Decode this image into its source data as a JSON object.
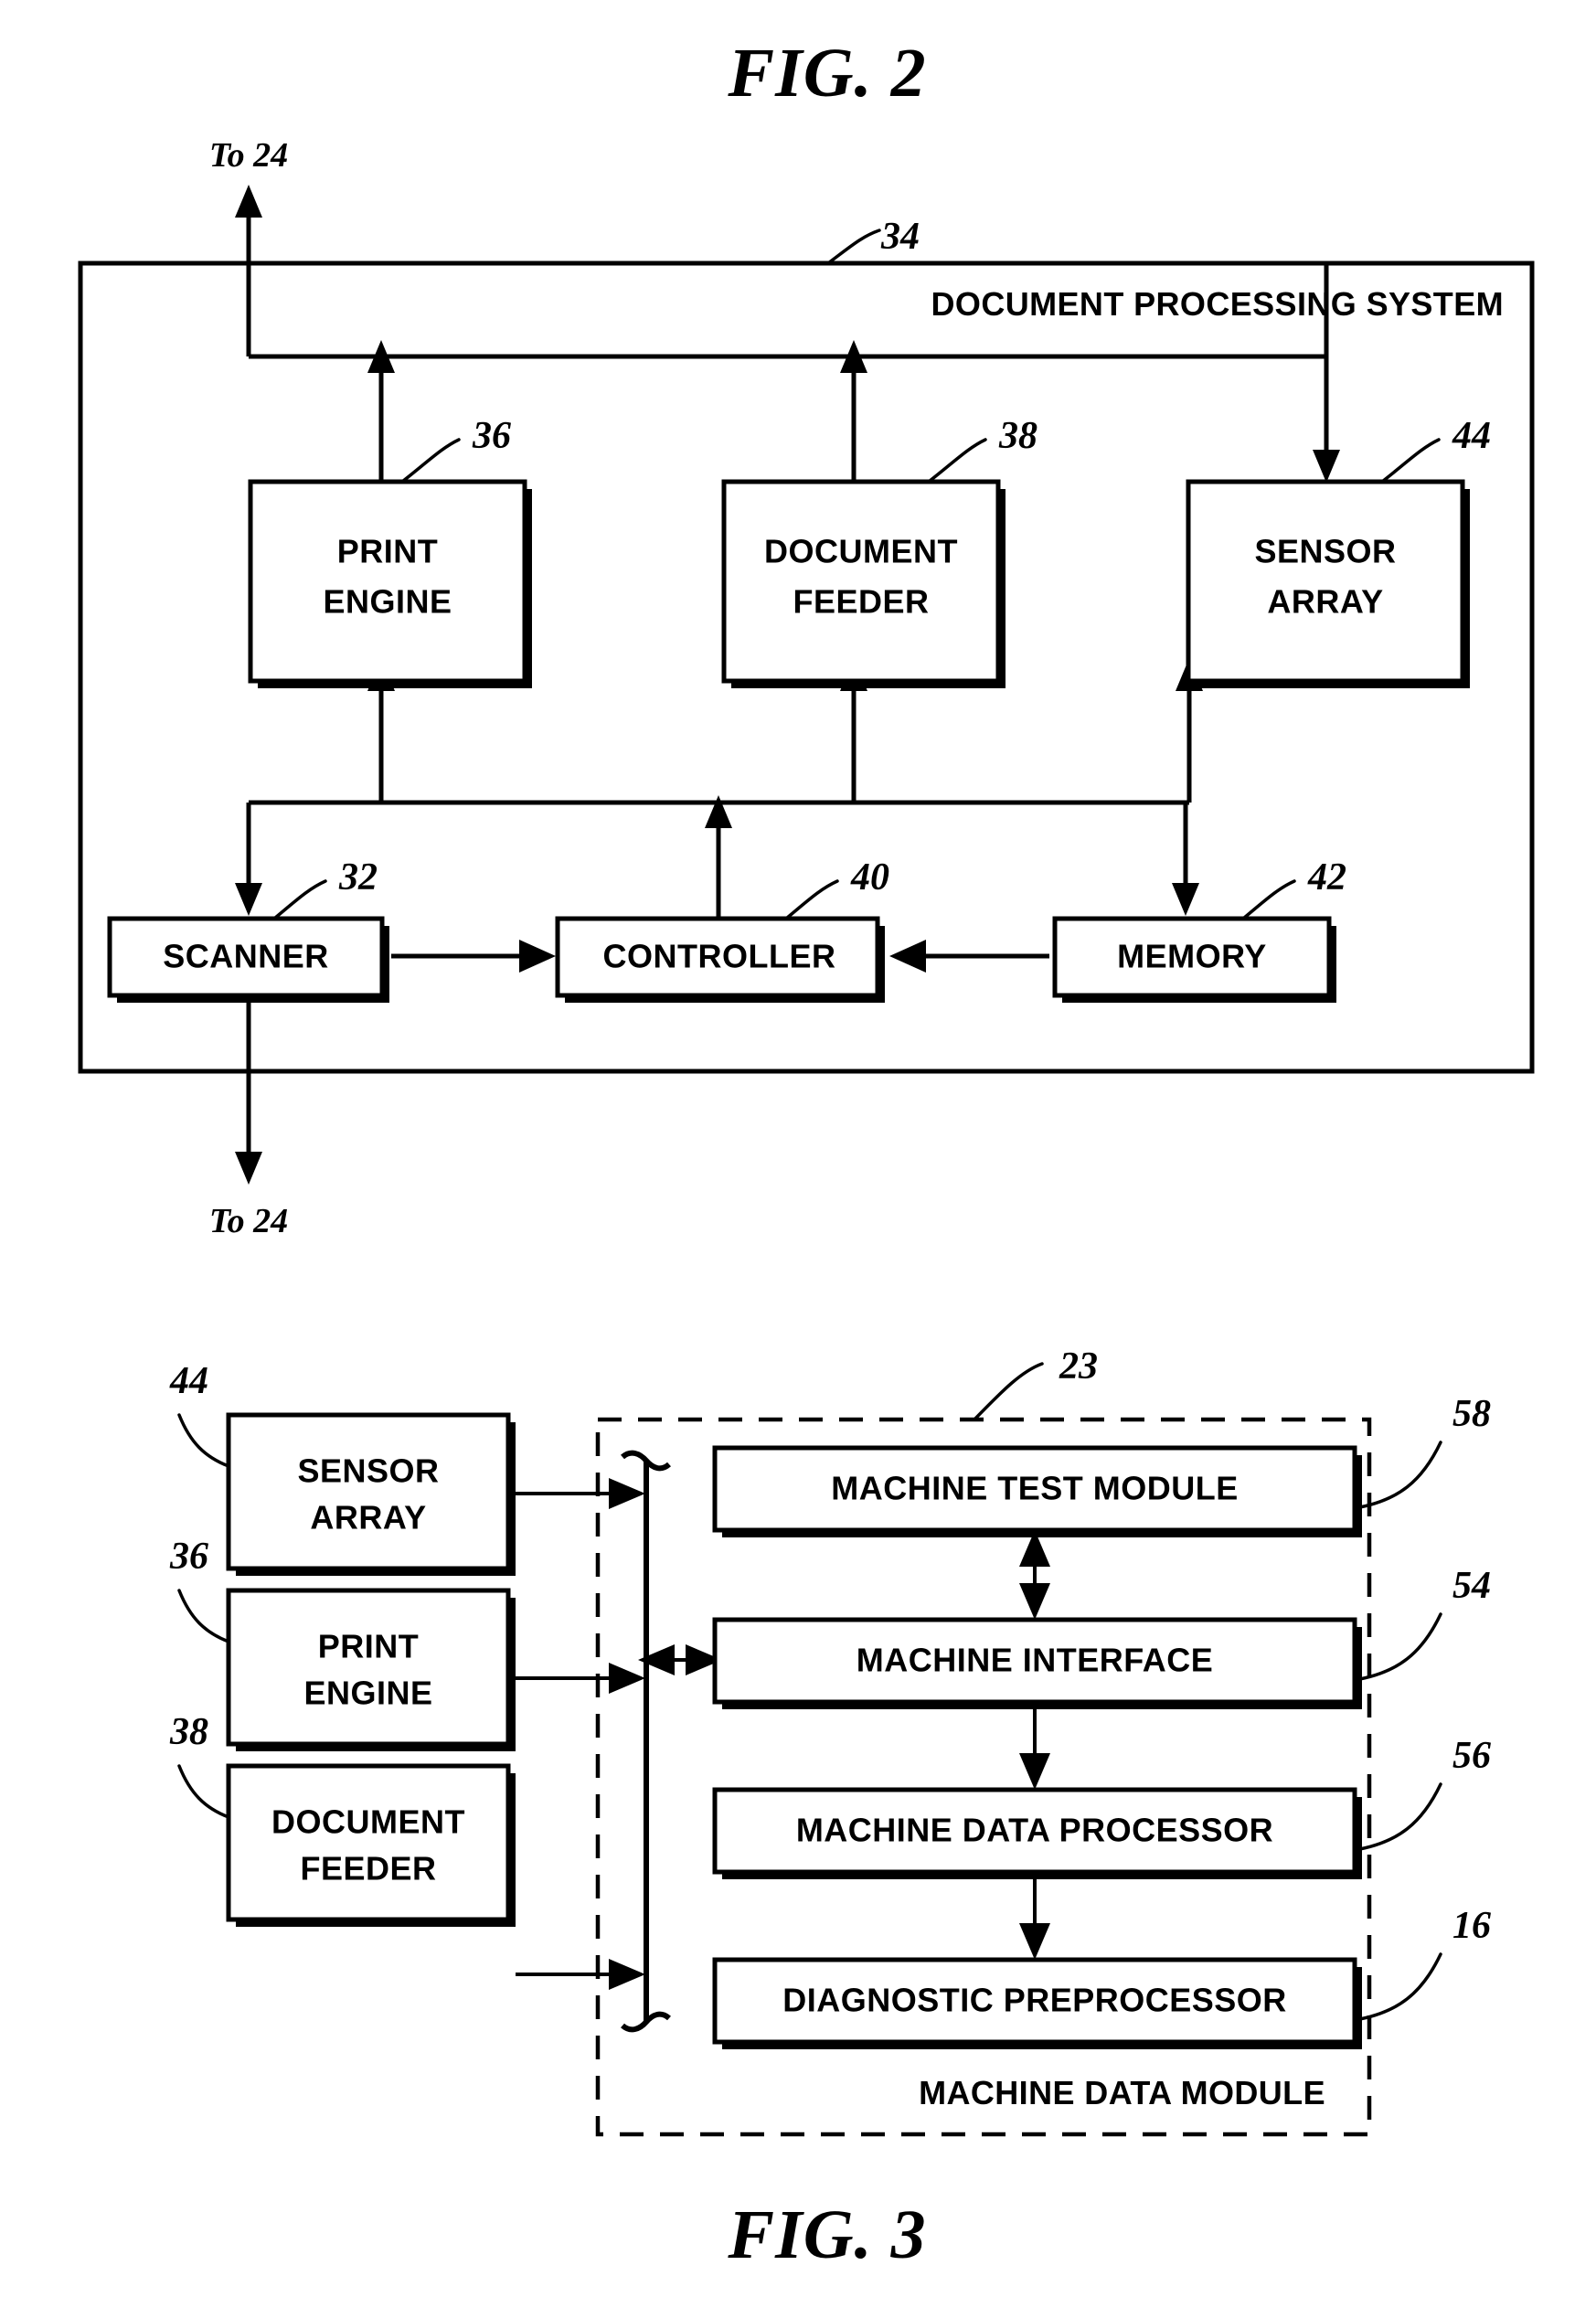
{
  "figure2": {
    "title": "FIG. 2",
    "system_label": "DOCUMENT PROCESSING SYSTEM",
    "system_ref": "34",
    "port_top": "To 24",
    "port_bottom": "To 24",
    "blocks": [
      {
        "id": "print-engine",
        "line1": "PRINT",
        "line2": "ENGINE",
        "ref": "36"
      },
      {
        "id": "document-feeder",
        "line1": "DOCUMENT",
        "line2": "FEEDER",
        "ref": "38"
      },
      {
        "id": "sensor-array",
        "line1": "SENSOR",
        "line2": "ARRAY",
        "ref": "44"
      },
      {
        "id": "scanner",
        "line1": "SCANNER",
        "line2": "",
        "ref": "32"
      },
      {
        "id": "controller",
        "line1": "CONTROLLER",
        "line2": "",
        "ref": "40"
      },
      {
        "id": "memory",
        "line1": "MEMORY",
        "line2": "",
        "ref": "42"
      }
    ]
  },
  "figure3": {
    "title": "FIG. 3",
    "module_label": "MACHINE DATA MODULE",
    "module_ref": "23",
    "sources": [
      {
        "id": "sensor-array",
        "line1": "SENSOR",
        "line2": "ARRAY",
        "ref": "44"
      },
      {
        "id": "print-engine",
        "line1": "PRINT",
        "line2": "ENGINE",
        "ref": "36"
      },
      {
        "id": "document-feeder",
        "line1": "DOCUMENT",
        "line2": "FEEDER",
        "ref": "38"
      }
    ],
    "modules": [
      {
        "id": "machine-test-module",
        "label": "MACHINE TEST MODULE",
        "ref": "58"
      },
      {
        "id": "machine-interface",
        "label": "MACHINE INTERFACE",
        "ref": "54"
      },
      {
        "id": "machine-data-processor",
        "label": "MACHINE DATA PROCESSOR",
        "ref": "56"
      },
      {
        "id": "diagnostic-preprocessor",
        "label": "DIAGNOSTIC PREPROCESSOR",
        "ref": "16"
      }
    ]
  },
  "colors": {
    "ink": "#000000",
    "paper": "#ffffff"
  }
}
